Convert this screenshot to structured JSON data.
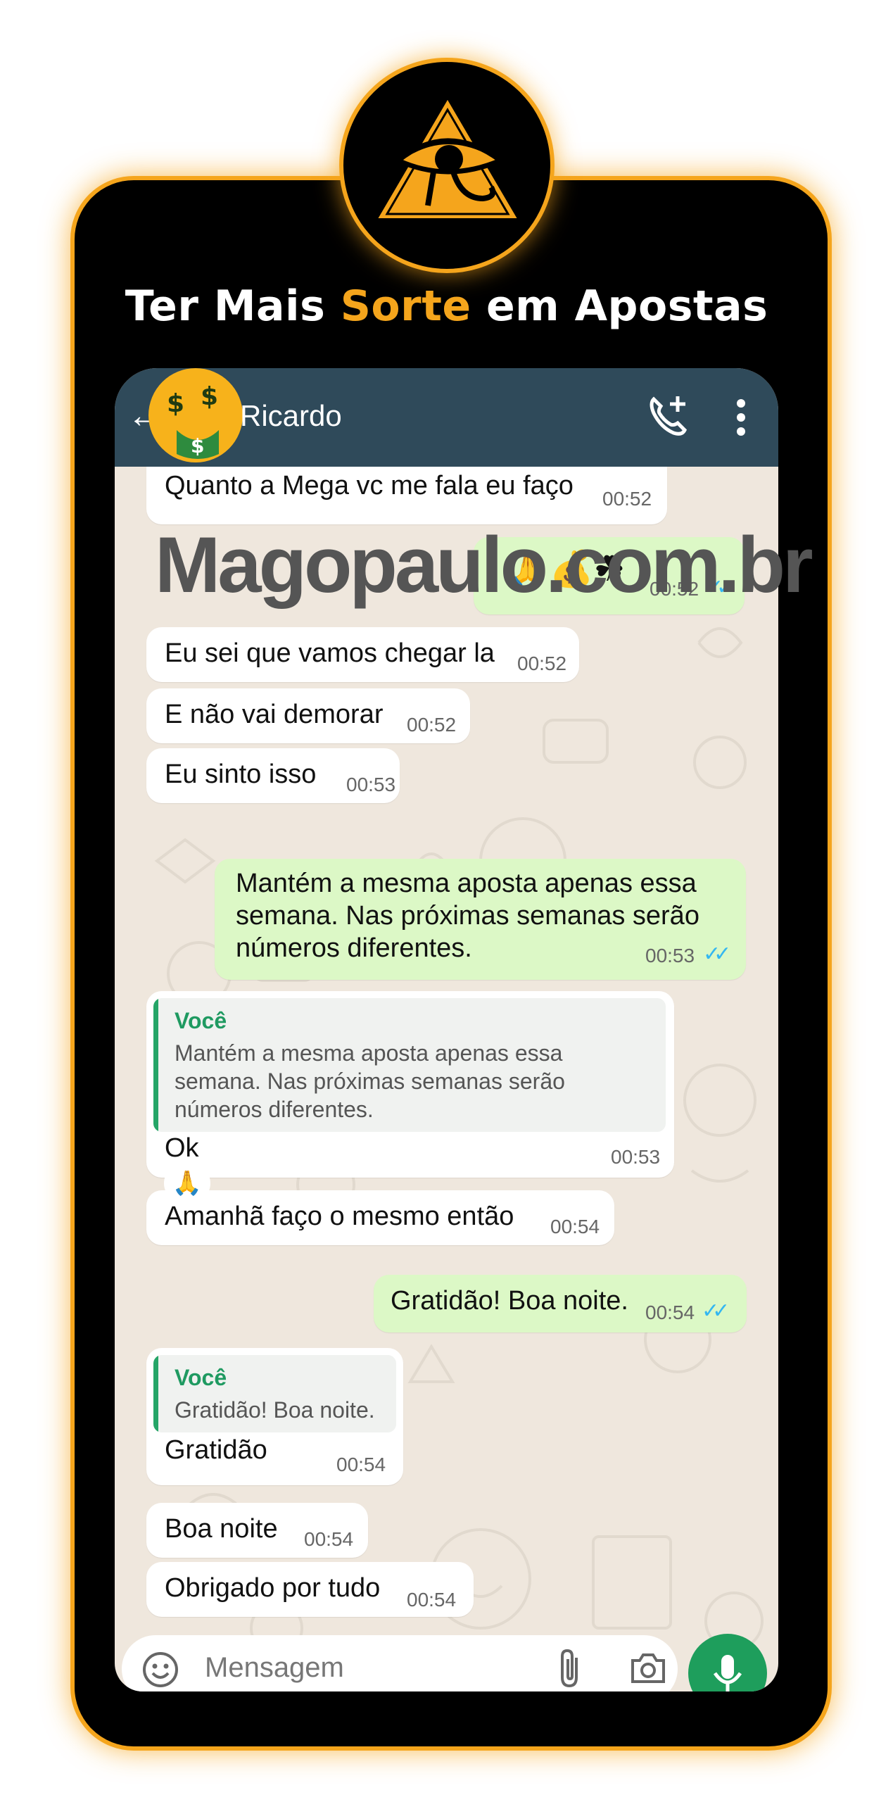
{
  "headline": {
    "before": "Ter Mais ",
    "accent": "Sorte",
    "after": " em Apostas"
  },
  "colors": {
    "accent": "#f5a51c",
    "header": "#2f4a5a",
    "outgoing": "#dcf8c6",
    "incoming": "#ffffff",
    "mic": "#1e9e5c"
  },
  "chat": {
    "contact_name": "Ricardo",
    "icons": [
      "back-arrow-icon",
      "add-call-icon",
      "more-menu-icon",
      "emoji-icon",
      "attach-icon",
      "camera-icon",
      "microphone-icon"
    ],
    "messages": [
      {
        "text": "Quanto a Mega vc me fala eu faço",
        "time": "00:52"
      },
      {
        "text": "🙏💰☘",
        "time": "00:52"
      },
      {
        "text": "Eu sei que vamos chegar la",
        "time": "00:52"
      },
      {
        "text": "E não vai demorar",
        "time": "00:52"
      },
      {
        "text": "Eu sinto isso",
        "time": "00:53"
      },
      {
        "line1": "Mantém a mesma aposta apenas essa",
        "line2": "semana. Nas próximas semanas serão",
        "line3": "números diferentes.",
        "time": "00:53"
      },
      {
        "quote_author": "Você",
        "quote_text": "Mantém a mesma aposta apenas essa semana. Nas próximas semanas serão números diferentes.",
        "text": "Ok",
        "time": "00:53"
      },
      {
        "text": "Amanhã faço o mesmo então",
        "time": "00:54"
      },
      {
        "text": "Gratidão! Boa noite.",
        "time": "00:54"
      },
      {
        "quote_author": "Você",
        "quote_text": "Gratidão! Boa noite.",
        "text": "Gratidão",
        "time": "00:54"
      },
      {
        "text": "Boa noite",
        "time": "00:54"
      },
      {
        "text": "Obrigado por tudo",
        "time": "00:54"
      }
    ],
    "reaction": "🙏",
    "input_placeholder": "Mensagem"
  },
  "watermark": "Magopaulo.com.br"
}
